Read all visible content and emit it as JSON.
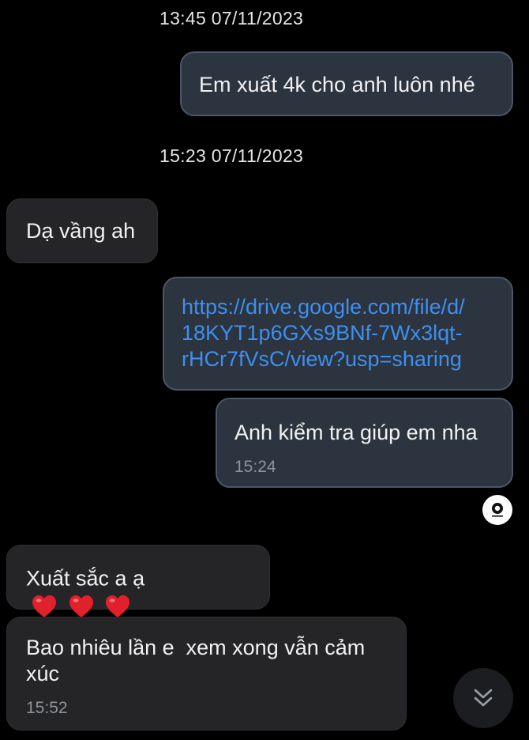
{
  "thread": {
    "timestamps": [
      "13:45 07/11/2023",
      "15:23 07/11/2023"
    ],
    "messages": [
      {
        "text": "Em xuất 4k cho anh luôn nhé"
      },
      {
        "text": "Dạ vầng ah"
      },
      {
        "link_lines": [
          "https://drive.google.com/file/d/",
          "18KYT1p6GXs9BNf-7Wx3lqt-",
          "rHCr7fVsC/view?usp=sharing"
        ]
      },
      {
        "text": "Anh kiểm tra giúp em nha",
        "time": "15:24"
      },
      {
        "text": "Xuất sắc a ạ"
      },
      {
        "lines": [
          "Bao nhiêu lần e  xem xong vẫn cảm",
          "xúc"
        ],
        "time": "15:52"
      }
    ]
  },
  "colors": {
    "background": "#000000",
    "sent_bubble": "#2c3440",
    "received_bubble": "#252527",
    "link": "#3d8ff0",
    "heart": "#e0202a"
  },
  "icons": {
    "reaction": "heart-icon",
    "seen": "avatar-icon",
    "scroll": "chevron-double-down-icon"
  }
}
